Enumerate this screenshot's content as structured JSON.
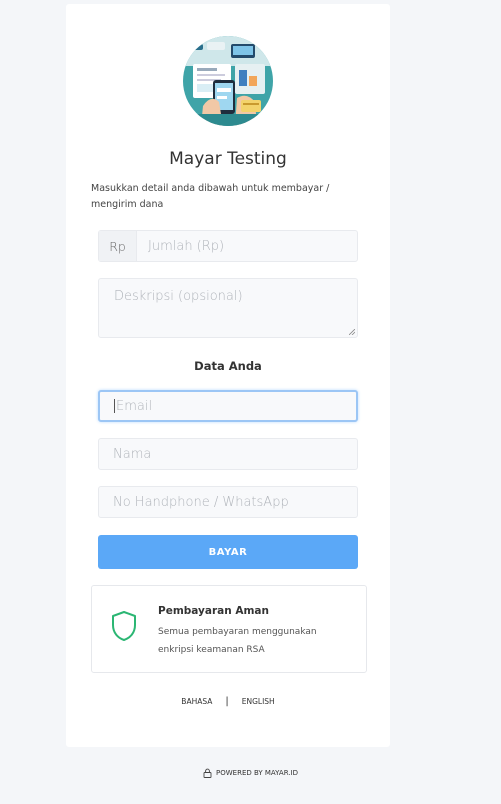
{
  "merchant": {
    "name": "Mayar Testing",
    "description": "Masukkan detail anda dibawah untuk membayar / mengirim dana",
    "avatar_icon": "payment-illustration-icon"
  },
  "payment_form": {
    "currency_prefix": "Rp",
    "amount_placeholder": "Jumlah (Rp)",
    "description_placeholder": "Deskripsi (opsional)"
  },
  "customer": {
    "section_title": "Data Anda",
    "email_placeholder": "Email",
    "name_placeholder": "Nama",
    "phone_placeholder": "No Handphone / WhatsApp"
  },
  "submit_label": "BAYAR",
  "security": {
    "title": "Pembayaran Aman",
    "text": "Semua pembayaran menggunakan enkripsi keamanan RSA",
    "icon": "shield-icon",
    "accent_color": "#2bb673"
  },
  "language": {
    "option_1": "BAHASA",
    "separator": "|",
    "option_2": "ENGLISH"
  },
  "footer": {
    "powered_by": "POWERED BY MAYAR.ID",
    "icon": "lock-icon"
  },
  "colors": {
    "primary_button": "#5ba8f7",
    "focus_border": "#9cc6f5",
    "page_background": "#f4f6f9"
  }
}
